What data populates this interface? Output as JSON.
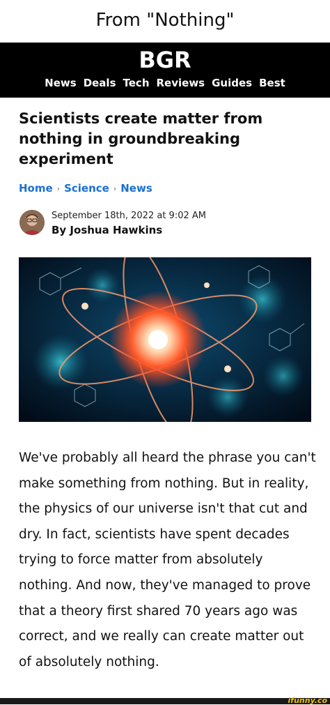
{
  "meme": {
    "caption": "From \"Nothing\""
  },
  "site": {
    "logo": "BGR",
    "nav": [
      "News",
      "Deals",
      "Tech",
      "Reviews",
      "Guides",
      "Best"
    ]
  },
  "article": {
    "headline": "Scientists create matter from nothing in groundbreaking experiment",
    "breadcrumb": [
      "Home",
      "Science",
      "News"
    ],
    "date": "September 18th, 2022 at 9:02 AM",
    "byline": "By Joshua Hawkins",
    "body": "We've probably all heard the phrase you can't make something from nothing. But in reality, the physics of our universe isn't that cut and dry. In fact, scientists have spent decades trying to force matter from absolutely nothing. And now, they've managed to prove that a theory first shared 70 years ago was correct, and we really can create matter out of absolutely nothing."
  },
  "watermark": "ifunny.co",
  "colors": {
    "header": "#000000",
    "link": "#1a6fd6",
    "watermark": "#f2c200"
  }
}
